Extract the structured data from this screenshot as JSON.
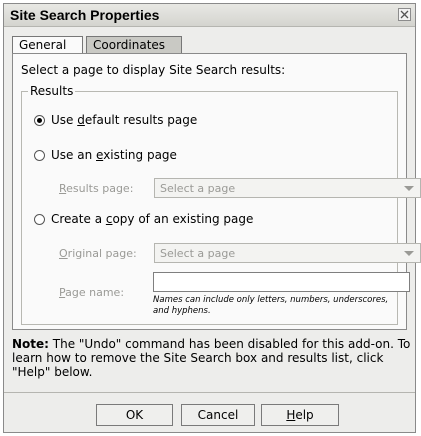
{
  "window": {
    "title": "Site Search Properties",
    "close_icon": "close-icon"
  },
  "tabs": [
    {
      "label": "General",
      "active": true
    },
    {
      "label": "Coordinates",
      "active": false
    }
  ],
  "intro": "Select a page to display Site Search results:",
  "group": {
    "legend": "Results",
    "radio_default": {
      "pre": "Use ",
      "key": "d",
      "post": "efault results page",
      "checked": true
    },
    "radio_existing": {
      "pre": "Use an ",
      "key": "e",
      "post": "xisting page",
      "checked": false
    },
    "results_page": {
      "key": "R",
      "label": "esults page:",
      "placeholder": "Select a page"
    },
    "radio_copy": {
      "pre": "Create a ",
      "key": "c",
      "post": "opy of an existing page",
      "checked": false
    },
    "original_page": {
      "key": "O",
      "label": "riginal page:",
      "placeholder": "Select a page"
    },
    "page_name": {
      "key": "P",
      "label": "age name:",
      "value": "",
      "hint": "Names can include only letters, numbers, underscores, and hyphens."
    }
  },
  "note": {
    "bold": "Note:",
    "text": " The \"Undo\" command has been disabled for this add-on. To learn how to remove the Site Search box and results list, click \"Help\" below."
  },
  "buttons": {
    "ok": "OK",
    "cancel": "Cancel",
    "help_key": "H",
    "help_rest": "elp"
  }
}
